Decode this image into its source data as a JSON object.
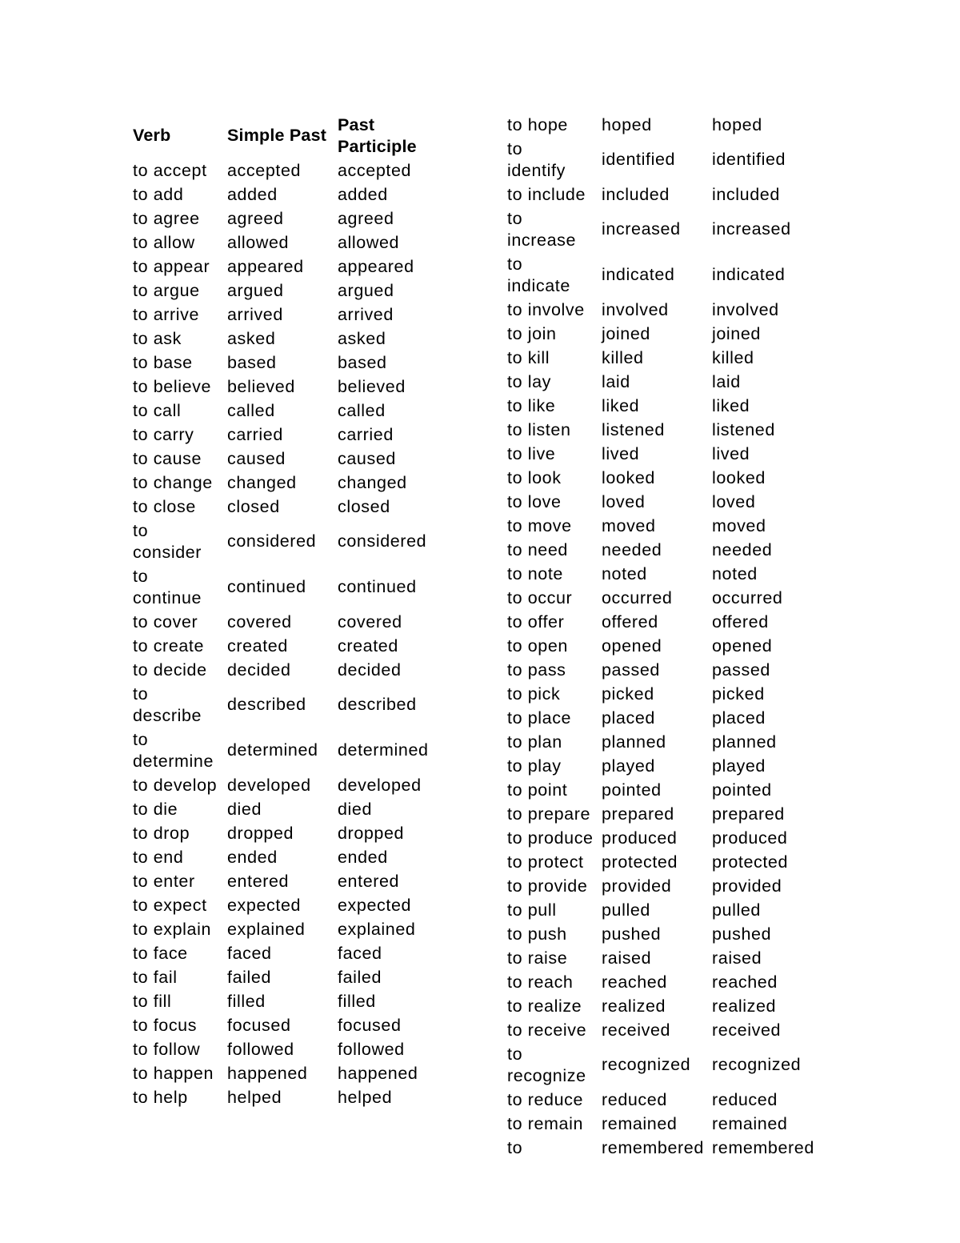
{
  "header": {
    "verb": "Verb",
    "simple_past": "Simple Past",
    "past_participle_line1": "Past",
    "past_participle_line2": "Participle"
  },
  "left_rows": [
    [
      "to accept",
      "accepted",
      "accepted"
    ],
    [
      "to add",
      "added",
      "added"
    ],
    [
      "to agree",
      "agreed",
      "agreed"
    ],
    [
      "to allow",
      "allowed",
      "allowed"
    ],
    [
      "to appear",
      "appeared",
      "appeared"
    ],
    [
      "to argue",
      "argued",
      "argued"
    ],
    [
      "to arrive",
      "arrived",
      "arrived"
    ],
    [
      "to ask",
      "asked",
      "asked"
    ],
    [
      "to base",
      "based",
      "based"
    ],
    [
      "to believe",
      "believed",
      "believed"
    ],
    [
      "to call",
      "called",
      "called"
    ],
    [
      "to carry",
      "carried",
      "carried"
    ],
    [
      "to cause",
      "caused",
      "caused"
    ],
    [
      "to change",
      "changed",
      "changed"
    ],
    [
      "to close",
      "closed",
      "closed"
    ],
    [
      "to consider",
      "considered",
      "considered"
    ],
    [
      "to continue",
      "continued",
      "continued"
    ],
    [
      "to cover",
      "covered",
      "covered"
    ],
    [
      "to create",
      "created",
      "created"
    ],
    [
      "to decide",
      "decided",
      "decided"
    ],
    [
      "to describe",
      "described",
      "described"
    ],
    [
      "to determine",
      "determined",
      "determined"
    ],
    [
      "to develop",
      "developed",
      "developed"
    ],
    [
      "to die",
      "died",
      "died"
    ],
    [
      "to drop",
      "dropped",
      "dropped"
    ],
    [
      "to end",
      "ended",
      "ended"
    ],
    [
      "to enter",
      "entered",
      "entered"
    ],
    [
      "to expect",
      "expected",
      "expected"
    ],
    [
      "to explain",
      "explained",
      "explained"
    ],
    [
      "to face",
      "faced",
      "faced"
    ],
    [
      "to fail",
      "failed",
      "failed"
    ],
    [
      "to fill",
      "filled",
      "filled"
    ],
    [
      "to focus",
      "focused",
      "focused"
    ],
    [
      "to follow",
      "followed",
      "followed"
    ],
    [
      "to happen",
      "happened",
      "happened"
    ],
    [
      "to help",
      "helped",
      "helped"
    ]
  ],
  "right_rows": [
    [
      "to hope",
      "hoped",
      "hoped"
    ],
    [
      "to identify",
      "identified",
      "identified"
    ],
    [
      "to include",
      "included",
      "included"
    ],
    [
      "to increase",
      "increased",
      "increased"
    ],
    [
      "to indicate",
      "indicated",
      "indicated"
    ],
    [
      "to involve",
      "involved",
      "involved"
    ],
    [
      "to join",
      "joined",
      "joined"
    ],
    [
      "to kill",
      "killed",
      "killed"
    ],
    [
      "to lay",
      "laid",
      "laid"
    ],
    [
      "to like",
      "liked",
      "liked"
    ],
    [
      "to listen",
      "listened",
      "listened"
    ],
    [
      "to live",
      "lived",
      "lived"
    ],
    [
      "to look",
      "looked",
      "looked"
    ],
    [
      "to love",
      "loved",
      "loved"
    ],
    [
      "to move",
      "moved",
      "moved"
    ],
    [
      "to need",
      "needed",
      "needed"
    ],
    [
      "to note",
      "noted",
      "noted"
    ],
    [
      "to occur",
      "occurred",
      "occurred"
    ],
    [
      "to offer",
      "offered",
      "offered"
    ],
    [
      "to open",
      "opened",
      "opened"
    ],
    [
      "to pass",
      "passed",
      "passed"
    ],
    [
      "to pick",
      "picked",
      "picked"
    ],
    [
      "to place",
      "placed",
      "placed"
    ],
    [
      "to plan",
      "planned",
      "planned"
    ],
    [
      "to play",
      "played",
      "played"
    ],
    [
      "to point",
      "pointed",
      "pointed"
    ],
    [
      "to prepare",
      "prepared",
      "prepared"
    ],
    [
      "to produce",
      "produced",
      "produced"
    ],
    [
      "to protect",
      "protected",
      "protected"
    ],
    [
      "to provide",
      "provided",
      "provided"
    ],
    [
      "to pull",
      "pulled",
      "pulled"
    ],
    [
      "to push",
      "pushed",
      "pushed"
    ],
    [
      "to raise",
      "raised",
      "raised"
    ],
    [
      "to reach",
      "reached",
      "reached"
    ],
    [
      "to realize",
      "realized",
      "realized"
    ],
    [
      "to receive",
      "received",
      "received"
    ],
    [
      "to recognize",
      "recognized",
      "recognized"
    ],
    [
      "to reduce",
      "reduced",
      "reduced"
    ],
    [
      "to remain",
      "remained",
      "remained"
    ],
    [
      "to",
      "remembered",
      "remembered"
    ]
  ]
}
